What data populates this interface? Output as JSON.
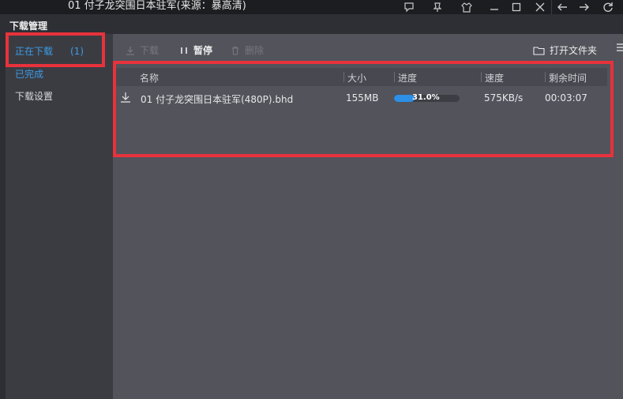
{
  "window": {
    "title": "01 付子龙突围日本驻军(来源：暴高清)"
  },
  "panel": {
    "title": "下载管理"
  },
  "sidebar": {
    "items": [
      {
        "label": "正在下载",
        "count": "(1)"
      },
      {
        "label": "已完成"
      },
      {
        "label": "下载设置"
      }
    ]
  },
  "toolbar": {
    "download_label": "下载",
    "pause_label": "暂停",
    "delete_label": "删除",
    "open_folder_label": "打开文件夹"
  },
  "table": {
    "columns": [
      "名称",
      "大小",
      "进度",
      "速度",
      "剩余时间"
    ],
    "rows": [
      {
        "name": "01 付子龙突围日本驻军(480P).bhd",
        "size": "155MB",
        "progress_text": "31.0%",
        "progress_value": 0.31,
        "speed": "575KB/s",
        "remaining": "00:03:07"
      }
    ]
  },
  "colors": {
    "accent": "#3a9ce6",
    "highlight_box": "#e8323b",
    "progress_fill": "#2d8fe6"
  },
  "icons": [
    "feedback-icon",
    "pin-icon",
    "skin-icon",
    "minimize-icon",
    "maximize-icon",
    "close-icon",
    "back-icon",
    "forward-icon",
    "refresh-icon",
    "download-icon",
    "pause-icon",
    "delete-icon",
    "folder-icon",
    "menu-icon"
  ]
}
